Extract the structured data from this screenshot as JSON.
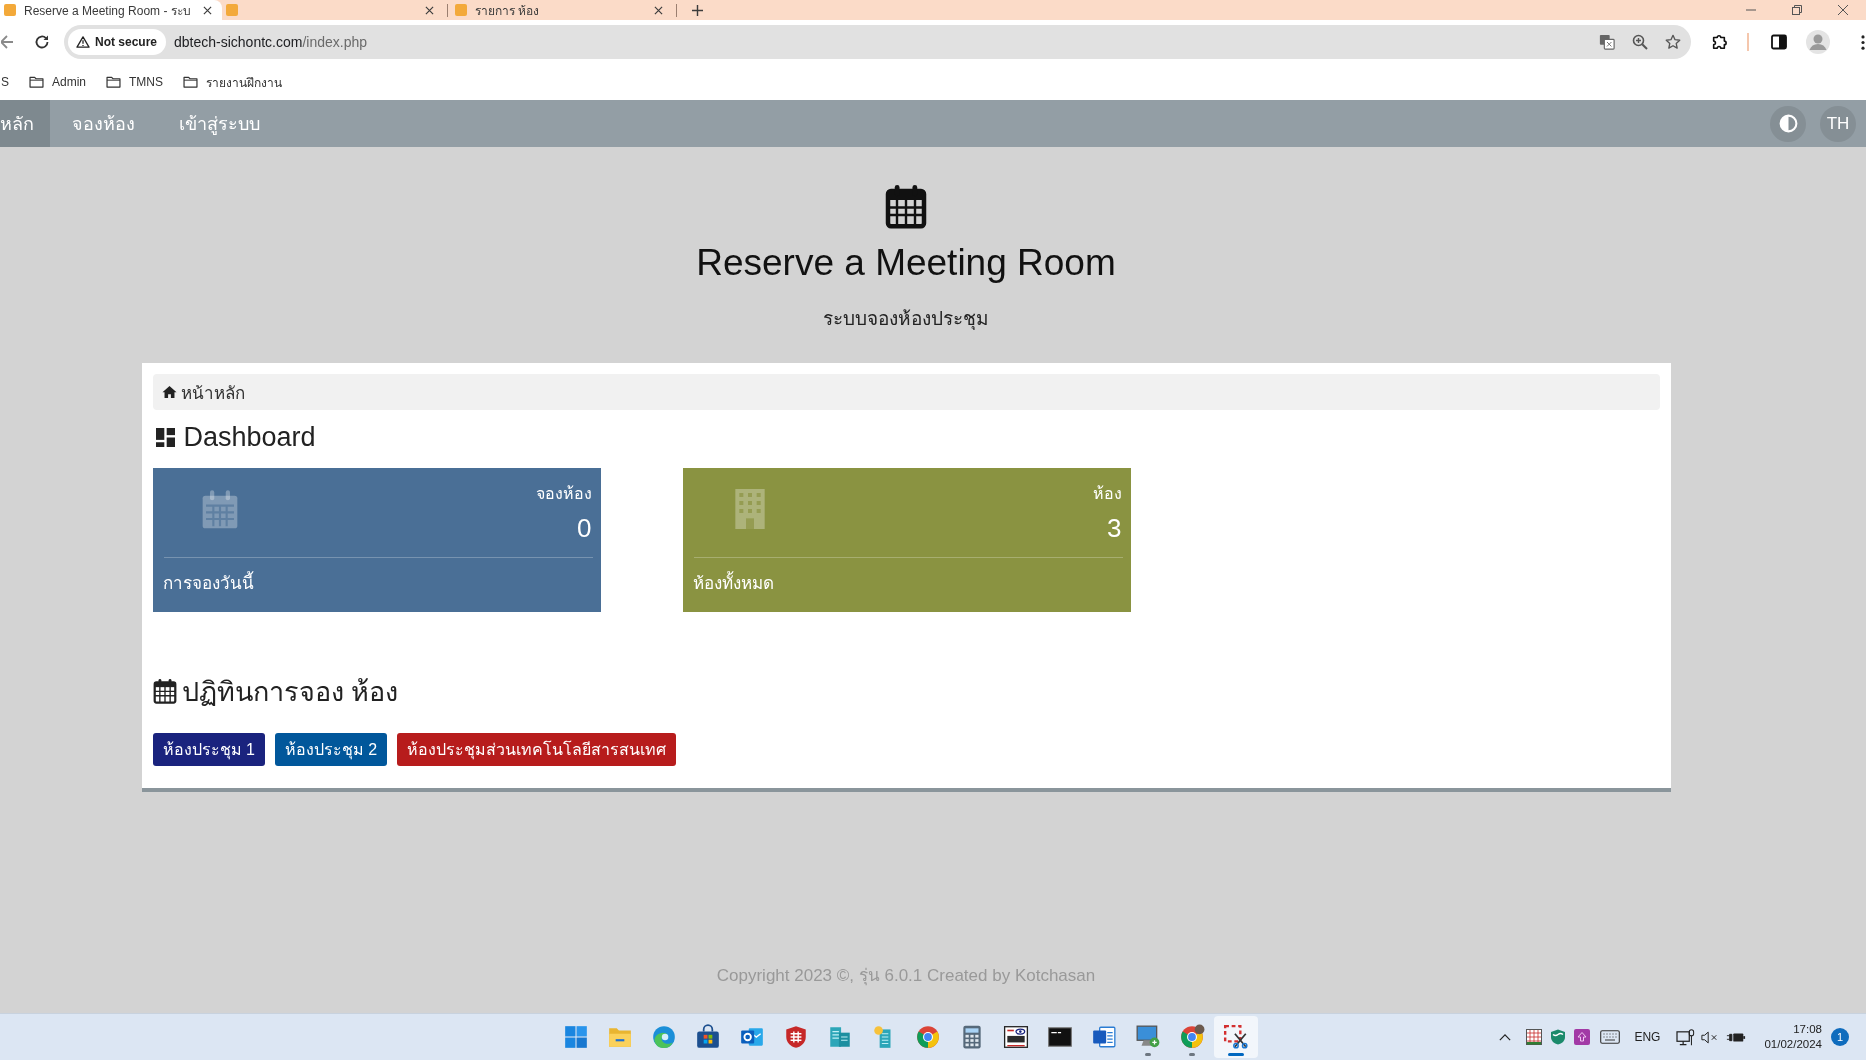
{
  "browser": {
    "tabs": [
      {
        "title": "Reserve a Meeting Room - ระบ",
        "selected": true
      },
      {
        "selected": false
      },
      {
        "title": "รายการ ห้อง",
        "selected": false
      }
    ],
    "address_bar": {
      "security_label": "Not secure",
      "host": "dbtech-sichontc.com",
      "path": "/index.php"
    },
    "bookmarks": [
      {
        "label": "S",
        "kind": "partial"
      },
      {
        "label": "Admin",
        "kind": "folder"
      },
      {
        "label": "TMNS",
        "kind": "folder"
      },
      {
        "label": "รายงานฝึกงาน",
        "kind": "folder"
      }
    ]
  },
  "navbar": {
    "items": [
      {
        "label": "หลัก",
        "selected": true
      },
      {
        "label": "จองห้อง",
        "selected": false
      },
      {
        "label": "เข้าสู่ระบบ",
        "selected": false
      }
    ],
    "language": "TH"
  },
  "header": {
    "title": "Reserve a Meeting Room",
    "subtitle": "ระบบจองห้องประชุม"
  },
  "breadcrumb": "หน้าหลัก",
  "dashboard": {
    "title": "Dashboard",
    "cards": [
      {
        "kind": "calendar",
        "label": "จองห้อง",
        "value": "0",
        "caption": "การจองวันนี้",
        "color": "#4a6f96"
      },
      {
        "kind": "building",
        "label": "ห้อง",
        "value": "3",
        "caption": "ห้องทั้งหมด",
        "color": "#8a9341"
      }
    ]
  },
  "calendar": {
    "title": "ปฏิทินการจอง ห้อง",
    "rooms": [
      {
        "name": "ห้องประชุม 1",
        "color": "#1a237e"
      },
      {
        "name": "ห้องประชุม 2",
        "color": "#01579b"
      },
      {
        "name": "ห้องประชุมส่วนเทคโนโลยีสารสนเทศ",
        "color": "#b71c1c"
      }
    ]
  },
  "footer": "Copyright 2023 ©, รุ่น 6.0.1 Created by Kotchasan",
  "taskbar": {
    "apps": [
      {
        "kind": "start",
        "running": false,
        "selected": false
      },
      {
        "kind": "explorer",
        "running": false,
        "selected": false
      },
      {
        "kind": "edge",
        "running": false,
        "selected": false
      },
      {
        "kind": "store",
        "running": false,
        "selected": false
      },
      {
        "kind": "mail",
        "running": false,
        "selected": false
      },
      {
        "kind": "shield",
        "running": false,
        "selected": false
      },
      {
        "kind": "servers",
        "running": false,
        "selected": false
      },
      {
        "kind": "server-sun",
        "running": false,
        "selected": false
      },
      {
        "kind": "chrome",
        "running": false,
        "selected": false
      },
      {
        "kind": "calculator",
        "running": false,
        "selected": false
      },
      {
        "kind": "vnc",
        "running": false,
        "selected": false
      },
      {
        "kind": "terminal",
        "running": false,
        "selected": false
      },
      {
        "kind": "word",
        "running": false,
        "selected": false
      },
      {
        "kind": "remote",
        "running": true,
        "selected": false
      },
      {
        "kind": "chrome-profile",
        "running": true,
        "selected": false
      },
      {
        "kind": "snip",
        "running": true,
        "selected": true
      }
    ],
    "language": "ENG",
    "time": "17:08",
    "date": "01/02/2024",
    "notifications": "1"
  }
}
